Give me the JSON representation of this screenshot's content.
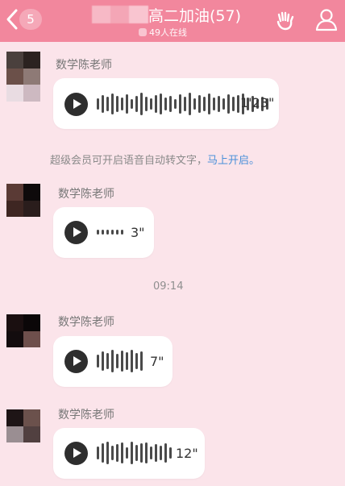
{
  "header": {
    "badge": "5",
    "title": "高二加油(57)",
    "online": "49人在线",
    "colors": {
      "bar": "#f2879d",
      "text": "#ffffff"
    },
    "icons": [
      "back-icon",
      "hand-icon",
      "group-profile-icon"
    ]
  },
  "notice": {
    "text": "超级会员可开启语音自动转文字，",
    "link": "马上开启。"
  },
  "timestamp": "09:14",
  "messages": [
    {
      "sender": "数学陈老师",
      "duration": "1'23\""
    },
    {
      "sender": "数学陈老师",
      "duration": "3\""
    },
    {
      "sender": "数学陈老师",
      "duration": "7\""
    },
    {
      "sender": "数学陈老师",
      "duration": "12\""
    }
  ],
  "colors": {
    "background": "#fbe4ea",
    "link": "#4a90d9",
    "play": "#2e2e2e"
  }
}
